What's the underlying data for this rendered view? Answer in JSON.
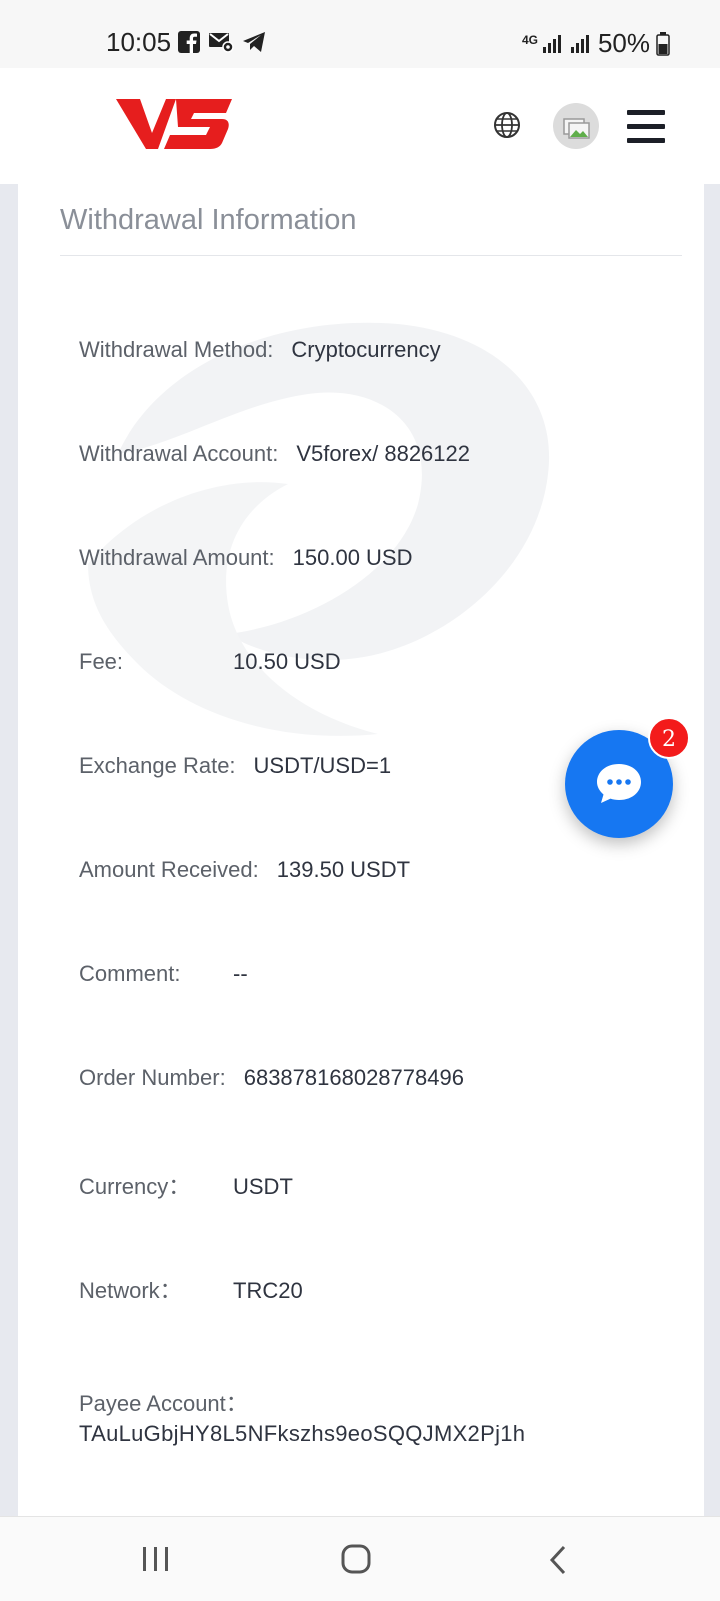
{
  "status_bar": {
    "time": "10:05",
    "network_type": "4G",
    "battery": "50%"
  },
  "header": {
    "logo_text": "V5",
    "brand_color": "#e61e1e"
  },
  "card": {
    "title": "Withdrawal Information",
    "rows": [
      {
        "label": "Withdrawal Method:",
        "value": "Cryptocurrency"
      },
      {
        "label": "Withdrawal Account:",
        "value": "V5forex/ 8826122"
      },
      {
        "label": "Withdrawal Amount:",
        "value": "150.00 USD"
      },
      {
        "label": "Fee:",
        "value": "10.50 USD"
      },
      {
        "label": "Exchange Rate:",
        "value": "USDT/USD=1"
      },
      {
        "label": "Amount Received:",
        "value": "139.50 USDT"
      },
      {
        "label": "Comment:",
        "value": "--"
      },
      {
        "label": "Order Number:",
        "value": "683878168028778496"
      },
      {
        "label": "Currency：",
        "value": "USDT"
      },
      {
        "label": "Network：",
        "value": "TRC20"
      }
    ],
    "payee_label": "Payee Account：",
    "payee_value": "TAuLuGbjHY8L5NFkszhs9eoSQQJMX2Pj1h"
  },
  "chat": {
    "badge_count": "2",
    "button_color": "#1677f2",
    "badge_color": "#f31b1b"
  },
  "nav_icons": [
    "recent-apps-icon",
    "home-icon",
    "back-icon"
  ]
}
